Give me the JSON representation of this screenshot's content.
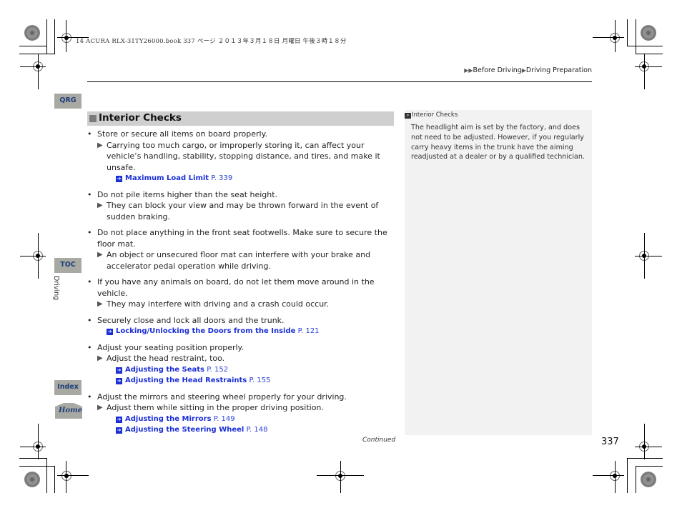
{
  "printer_header": "14 ACURA RLX-31TY26000.book  337 ページ  ２０１３年３月１８日  月曜日  午後３時１８分",
  "breadcrumb": {
    "items": [
      "Before Driving",
      "Driving Preparation"
    ],
    "separator_icon": "triangle-right-icon"
  },
  "side_nav": {
    "qrg": "QRG",
    "toc": "TOC",
    "chapter": "Driving",
    "index": "Index",
    "home": "Home"
  },
  "section": {
    "title": "Interior Checks",
    "items": [
      {
        "text": "Store or secure all items on board properly.",
        "subs": [
          "Carrying too much cargo, or improperly storing it, can affect your vehicle’s handling, stability, stopping distance, and tires, and make it unsafe."
        ],
        "xrefs": [
          {
            "label": "Maximum Load Limit",
            "page": "P. 339"
          }
        ]
      },
      {
        "text": "Do not pile items higher than the seat height.",
        "subs": [
          "They can block your view and may be thrown forward in the event of sudden braking."
        ],
        "xrefs": []
      },
      {
        "text": "Do not place anything in the front seat footwells. Make sure to secure the floor mat.",
        "subs": [
          "An object or unsecured floor mat can interfere with your brake and accelerator pedal operation while driving."
        ],
        "xrefs": []
      },
      {
        "text": "If you have any animals on board, do not let them move around in the vehicle.",
        "subs": [
          "They may interfere with driving and a crash could occur."
        ],
        "xrefs": []
      },
      {
        "text": "Securely close and lock all doors and the trunk.",
        "subs": [],
        "xrefs": [
          {
            "label": "Locking/Unlocking the Doors from the Inside",
            "page": "P. 121"
          }
        ]
      },
      {
        "text": "Adjust your seating position properly.",
        "subs": [
          "Adjust the head restraint, too."
        ],
        "xrefs": [
          {
            "label": "Adjusting the Seats",
            "page": "P. 152"
          },
          {
            "label": "Adjusting the Head Restraints",
            "page": "P. 155"
          }
        ]
      },
      {
        "text": "Adjust the mirrors and steering wheel properly for your driving.",
        "subs": [
          "Adjust them while sitting in the proper driving position."
        ],
        "xrefs": [
          {
            "label": "Adjusting the Mirrors",
            "page": "P. 149"
          },
          {
            "label": "Adjusting the Steering Wheel",
            "page": "P. 148"
          }
        ]
      }
    ]
  },
  "sidebar_note": {
    "heading": "Interior Checks",
    "body": "The headlight aim is set by the factory, and does not need to be adjusted. However, if you regularly carry heavy items in the trunk have the aiming readjusted at a dealer or by a qualified technician."
  },
  "footer": {
    "continued": "Continued",
    "page_number": "337"
  },
  "colors": {
    "link": "#1b2fd6",
    "tab_bg": "#a9a9a3",
    "tab_text": "#1e3f7a",
    "section_bg": "#cfcfcf",
    "note_bg": "#f2f2f2"
  }
}
